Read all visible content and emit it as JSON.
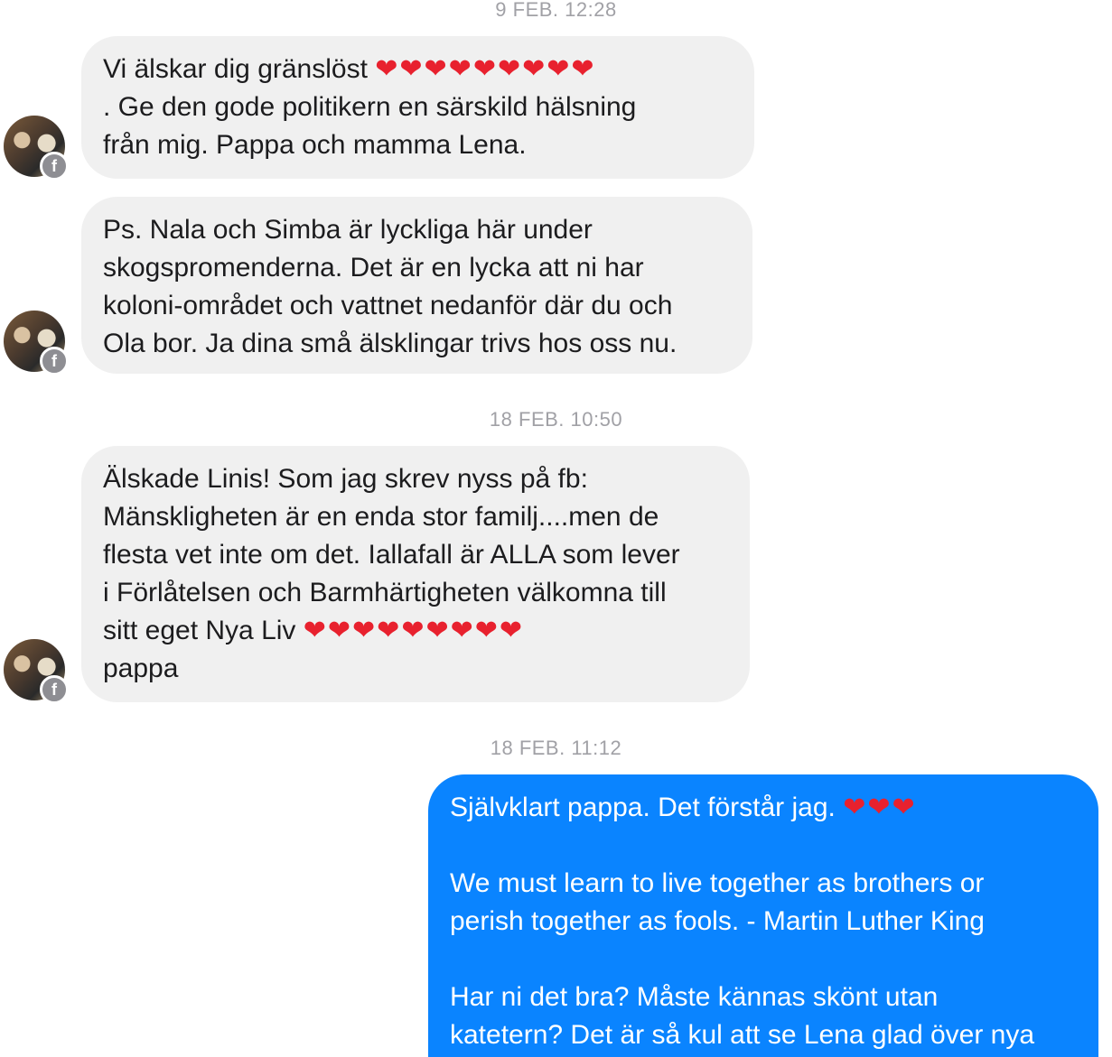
{
  "timestamps": {
    "t1": "9 FEB. 12:28",
    "t2": "18 FEB. 10:50",
    "t3": "18 FEB. 11:12"
  },
  "messages": [
    {
      "direction": "incoming",
      "lines": [
        {
          "text": "Vi älskar dig gränslöst ",
          "hearts": "❤❤❤❤❤❤❤❤❤"
        },
        {
          "text": ".  Ge  den gode politikern en särskild hälsning"
        },
        {
          "text": "från mig. Pappa och mamma Lena."
        }
      ]
    },
    {
      "direction": "incoming",
      "lines": [
        {
          "text": "Ps. Nala och Simba är lyckliga här under"
        },
        {
          "text": "skogspromenderna. Det är en lycka att ni har"
        },
        {
          "text": "koloni-området och vattnet nedanför där du och"
        },
        {
          "text": "Ola bor. Ja dina små älsklingar trivs hos oss nu."
        }
      ]
    },
    {
      "direction": "incoming",
      "lines": [
        {
          "text": "Älskade Linis! Som jag skrev nyss på fb:"
        },
        {
          "text": "Mänskligheten är en enda stor familj....men de"
        },
        {
          "text": "flesta vet inte om det. Iallafall är ALLA som lever"
        },
        {
          "text": "i Förlåtelsen och Barmhärtigheten välkomna till"
        },
        {
          "text": "sitt eget Nya Liv ",
          "hearts": "❤❤❤❤❤❤❤❤❤"
        },
        {
          "text": "pappa"
        }
      ]
    },
    {
      "direction": "outgoing",
      "lines": [
        {
          "text": "Självklart pappa. Det förstår jag. ",
          "hearts": "❤❤❤"
        },
        {
          "text": ""
        },
        {
          "text": "We must learn to live together as brothers or"
        },
        {
          "text": "perish together as fools. - Martin Luther King"
        },
        {
          "text": ""
        },
        {
          "text": "Har ni det bra? Måste kännas skönt utan"
        },
        {
          "text": "katetern? Det är så kul att se Lena glad över nya"
        }
      ]
    }
  ],
  "avatar": {
    "icon": "facebook-badge-icon",
    "badge_glyph": "f"
  },
  "colors": {
    "incoming_bubble": "#f0f0f0",
    "outgoing_bubble": "#0a84ff",
    "heart": "#e8212e",
    "timestamp": "#a1a1a6"
  }
}
